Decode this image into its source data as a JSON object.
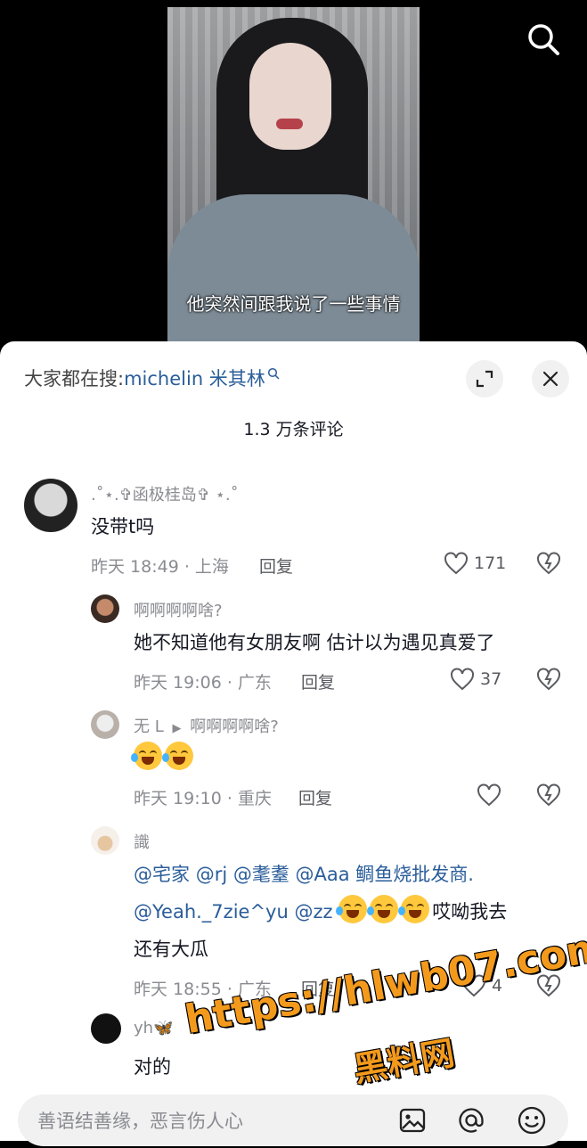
{
  "video": {
    "subtitle": "他突然间跟我说了一些事情"
  },
  "sheet": {
    "search_prefix": "大家都在搜:",
    "search_keyword": "michelin 米其林",
    "comment_count": "1.3 万条评论"
  },
  "comments": [
    {
      "username": ".˚⋆.✞函极桂岛✞ ⋆.˚",
      "text": "没带t吗",
      "meta": "昨天 18:49 · 上海",
      "reply": "回复",
      "likes": "171"
    },
    {
      "username": "啊啊啊啊啥?",
      "text": "她不知道他有女朋友啊 估计以为遇见真爱了",
      "meta": "昨天 19:06 · 广东",
      "reply": "回复",
      "likes": "37"
    },
    {
      "username": "无 L",
      "reply_to": "啊啊啊啊啥?",
      "meta": "昨天 19:10 · 重庆",
      "reply": "回复",
      "likes": ""
    },
    {
      "username": "識",
      "line1_mentions": [
        "@宅家",
        "@rj",
        "@耄耋",
        "@Aaa 鲷鱼烧批发商."
      ],
      "line2_mentions": [
        "@Yeah._7zie^yu",
        "@zz"
      ],
      "line2_tail": "哎呦我去",
      "line3": "还有大瓜",
      "meta": "昨天 18:55 · 广东",
      "reply": "回复",
      "likes": "4"
    },
    {
      "username": "yh🦋",
      "text": "对的"
    }
  ],
  "input": {
    "placeholder": "善语结善缘，恶言伤人心"
  },
  "watermark": {
    "url": "https://hlwb07.com",
    "name": "黑料网"
  },
  "icons": [
    "search-icon",
    "expand-icon",
    "close-icon",
    "heart-icon",
    "broken-heart-icon",
    "image-icon",
    "at-icon",
    "emoji-icon"
  ]
}
